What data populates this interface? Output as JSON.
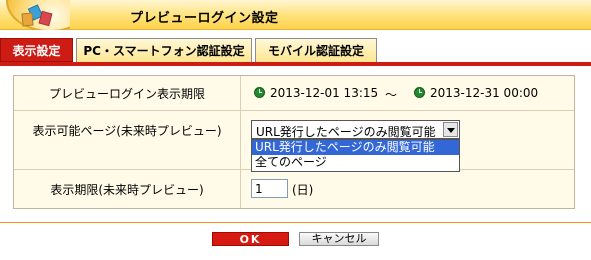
{
  "header": {
    "title": "プレビューログイン設定"
  },
  "tabs": [
    {
      "label": "表示設定",
      "active": true
    },
    {
      "label": "PC・スマートフォン認証設定",
      "active": false
    },
    {
      "label": "モバイル認証設定",
      "active": false
    }
  ],
  "form": {
    "period": {
      "label": "プレビューログイン表示期限",
      "start": "2013-12-01 13:15",
      "separator": "〜",
      "end": "2013-12-31 00:00"
    },
    "viewable_pages": {
      "label": "表示可能ページ(未来時プレビュー)",
      "selected": "URL発行したページのみ閲覧可能",
      "options": [
        "URL発行したページのみ閲覧可能",
        "全てのページ"
      ]
    },
    "display_period": {
      "label": "表示期限(未来時プレビュー)",
      "value": "1",
      "unit": "(日)"
    }
  },
  "footer": {
    "ok_label": "OK",
    "cancel_label": "キャンセル"
  },
  "colors": {
    "accent_red": "#cc1c14",
    "tab_yellow": "#ffe690",
    "panel_bg": "#fffbe8",
    "highlight_blue": "#3367d6"
  }
}
